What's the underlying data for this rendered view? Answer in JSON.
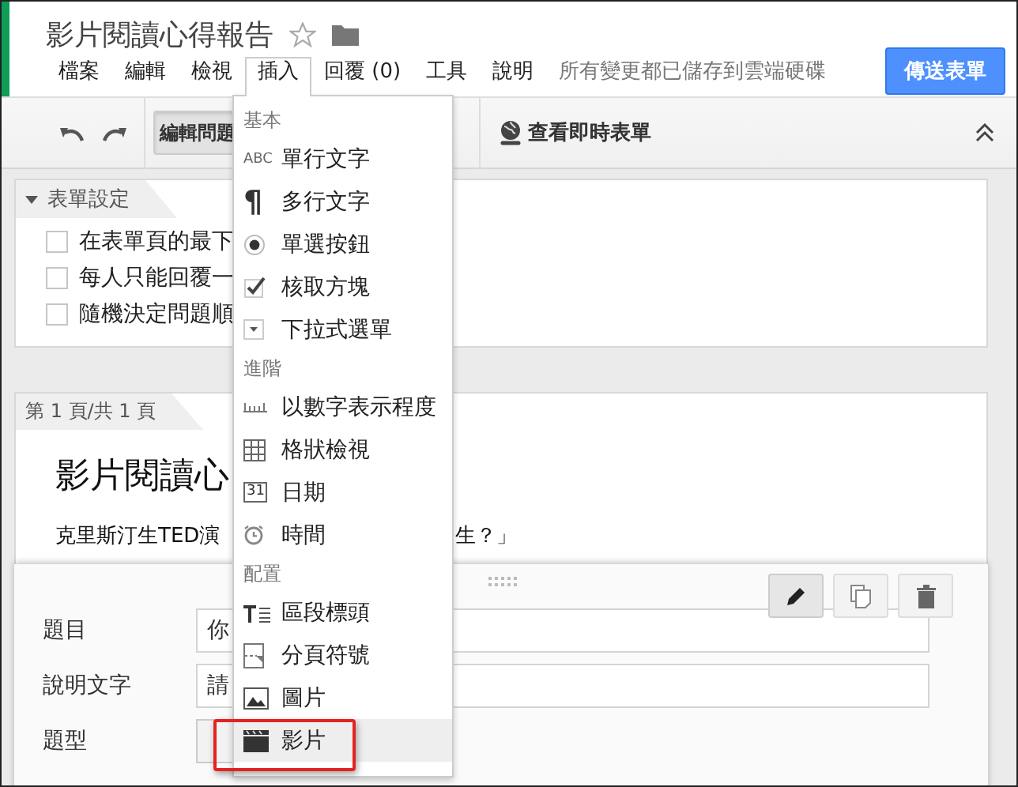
{
  "document": {
    "title": "影片閱讀心得報告",
    "starred": false
  },
  "menu_bar": [
    {
      "label": "檔案",
      "open": false
    },
    {
      "label": "編輯",
      "open": false
    },
    {
      "label": "檢視",
      "open": false
    },
    {
      "label": "插入",
      "open": true
    },
    {
      "label": "回覆 (0)",
      "open": false
    },
    {
      "label": "工具",
      "open": false
    },
    {
      "label": "說明",
      "open": false
    }
  ],
  "save_status": "所有變更都已儲存到雲端硬碟",
  "send_button": "傳送表單",
  "toolbar": {
    "edit_questions": {
      "label": "編輯問題",
      "selected": true
    },
    "view_live": "查看即時表單"
  },
  "form_settings": {
    "heading": "表單設定",
    "options": [
      {
        "label": "在表單頁的最下",
        "checked": false
      },
      {
        "label": "每人只能回覆一",
        "checked": false
      },
      {
        "label": "隨機決定問題順",
        "checked": false
      }
    ]
  },
  "page": {
    "indicator": "第 1 頁/共 1 頁",
    "title": "影片閱讀心",
    "description_start": "克里斯汀生TED演",
    "description_end": "生？」"
  },
  "question_editor": {
    "fields": [
      {
        "label": "題目",
        "value": "你",
        "kind": "text"
      },
      {
        "label": "說明文字",
        "value": "請",
        "kind": "text"
      },
      {
        "label": "題型",
        "kind": "select"
      }
    ]
  },
  "insert_menu": [
    {
      "heading": "基本",
      "items": [
        {
          "label": "單行文字",
          "kind": "text",
          "icon_text": "ABC",
          "selected": false
        },
        {
          "label": "多行文字",
          "kind": "paragraph",
          "icon_text": "¶",
          "selected": false
        },
        {
          "label": "單選按鈕",
          "kind": "radio",
          "selected": false
        },
        {
          "label": "核取方塊",
          "kind": "checkbox",
          "selected": false
        },
        {
          "label": "下拉式選單",
          "kind": "dropdown",
          "selected": false
        }
      ]
    },
    {
      "heading": "進階",
      "items": [
        {
          "label": "以數字表示程度",
          "kind": "scale",
          "selected": false
        },
        {
          "label": "格狀檢視",
          "kind": "grid",
          "selected": false
        },
        {
          "label": "日期",
          "kind": "date",
          "icon_text": "31",
          "selected": false
        },
        {
          "label": "時間",
          "kind": "time",
          "selected": false
        }
      ]
    },
    {
      "heading": "配置",
      "items": [
        {
          "label": "區段標頭",
          "kind": "section",
          "selected": false
        },
        {
          "label": "分頁符號",
          "kind": "pagebreak",
          "selected": false
        },
        {
          "label": "圖片",
          "kind": "image",
          "selected": false
        },
        {
          "label": "影片",
          "kind": "video",
          "selected": true
        }
      ]
    }
  ]
}
